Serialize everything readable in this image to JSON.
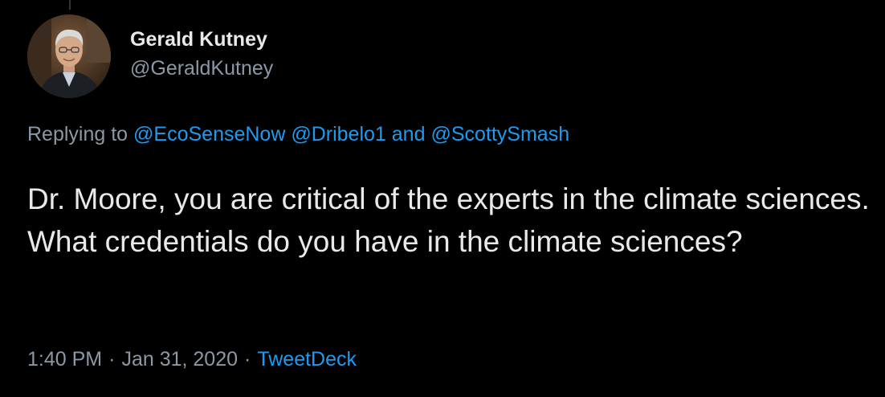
{
  "tweet": {
    "author": {
      "display_name": "Gerald Kutney",
      "handle": "@GeraldKutney"
    },
    "replying": {
      "prefix": "Replying to",
      "mention_1": "@EcoSenseNow",
      "mention_2": "@Dribelo1",
      "conjunction": "and",
      "mention_3": "@ScottySmash"
    },
    "text": "Dr. Moore, you are critical of the experts in the climate sciences. What credentials do you have in the climate sciences?",
    "meta": {
      "time": "1:40 PM",
      "separator": "·",
      "date": "Jan 31, 2020",
      "source": "TweetDeck"
    }
  },
  "colors": {
    "background": "#000000",
    "primary_text": "#e7e9ea",
    "secondary_text": "#8b98a5",
    "link": "#1d9bf0"
  },
  "icons": {
    "avatar": "profile-photo"
  }
}
